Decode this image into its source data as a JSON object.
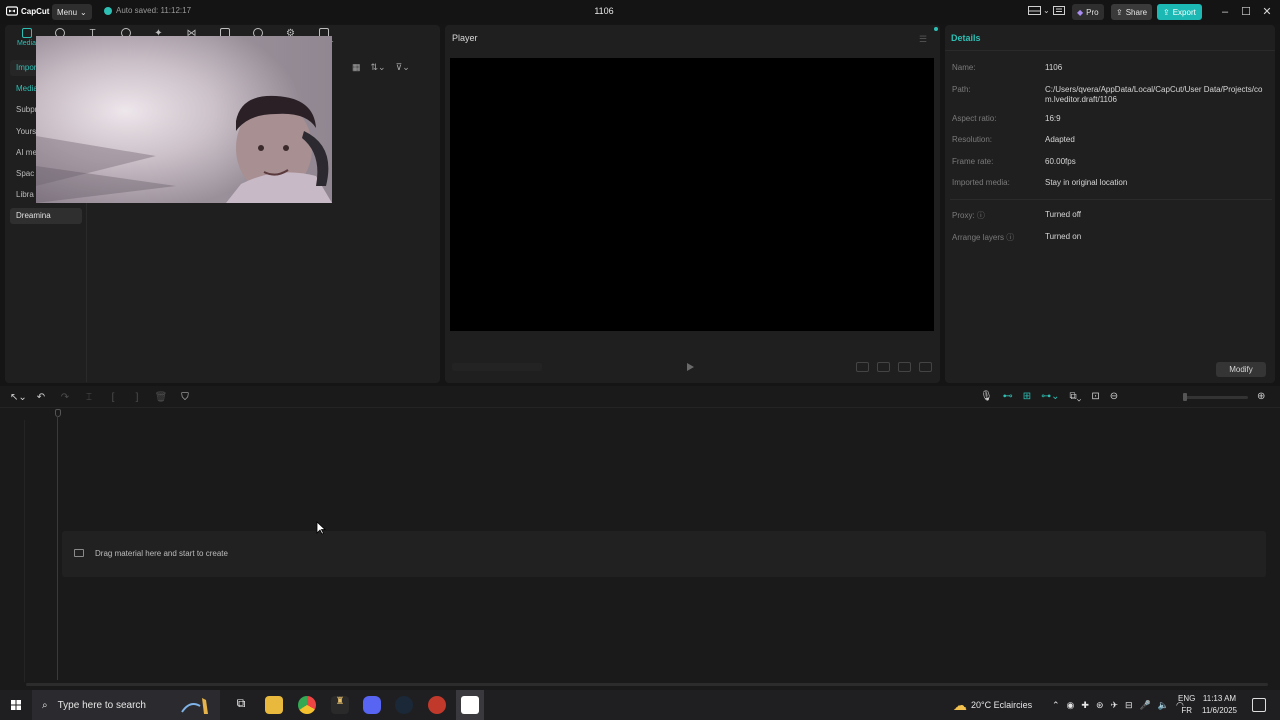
{
  "app": {
    "name": "CapCut",
    "menu_label": "Menu",
    "autosave": "Auto saved: 11:12:17",
    "project_title": "1106",
    "pro_label": "Pro",
    "share_label": "Share",
    "export_label": "Export"
  },
  "media_toolbar": {
    "tabs": [
      {
        "label": "Media",
        "active": true
      },
      {
        "label": ""
      },
      {
        "label": ""
      },
      {
        "label": ""
      },
      {
        "label": ""
      },
      {
        "label": ""
      },
      {
        "label": ""
      },
      {
        "label": ""
      },
      {
        "label": ""
      },
      {
        "label": "avatar"
      }
    ]
  },
  "media_sidebar": {
    "items": [
      {
        "label": "Import",
        "state": "active"
      },
      {
        "label": "Media",
        "state": "active"
      },
      {
        "label": "Subpr",
        "state": ""
      },
      {
        "label": "Yours",
        "state": ""
      },
      {
        "label": "AI me",
        "state": ""
      },
      {
        "label": "Spac",
        "state": ""
      },
      {
        "label": "Libra",
        "state": ""
      },
      {
        "label": "Dreamina",
        "state": "selected"
      }
    ]
  },
  "player": {
    "title": "Player"
  },
  "details": {
    "title": "Details",
    "rows": [
      {
        "label": "Name:",
        "value": "1106"
      },
      {
        "label": "Path:",
        "value": "C:/Users/qvera/AppData/Local/CapCut/User Data/Projects/com.lveditor.draft/1106"
      },
      {
        "label": "Aspect ratio:",
        "value": "16:9"
      },
      {
        "label": "Resolution:",
        "value": "Adapted"
      },
      {
        "label": "Frame rate:",
        "value": "60.00fps"
      },
      {
        "label": "Imported media:",
        "value": "Stay in original location"
      },
      {
        "label": "Proxy:",
        "value": "Turned off"
      },
      {
        "label": "Arrange layers",
        "value": "Turned on"
      }
    ],
    "modify_label": "Modify"
  },
  "timeline": {
    "drop_hint": "Drag material here and start to create"
  },
  "taskbar": {
    "search_placeholder": "Type here to search",
    "weather": "20°C  Eclaircies",
    "lang_top": "ENG",
    "lang_bottom": "FR",
    "time": "11:13 AM",
    "date": "11/6/2025"
  },
  "colors": {
    "accent": "#2dbfb4",
    "background": "#151515",
    "panel": "#1f1f1f"
  }
}
